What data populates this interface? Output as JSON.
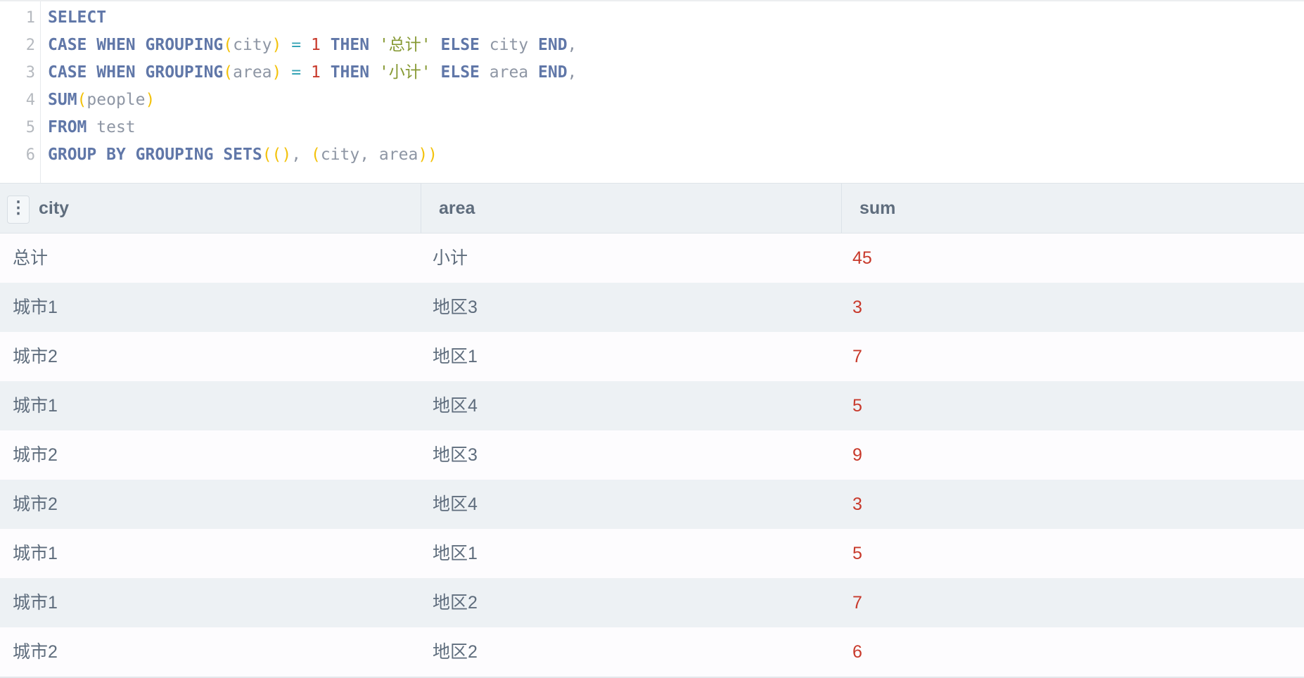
{
  "editor": {
    "line_numbers": [
      "1",
      "2",
      "3",
      "4",
      "5",
      "6"
    ],
    "lines": [
      [
        {
          "t": "SELECT",
          "k": "kw"
        }
      ],
      [
        {
          "t": "CASE",
          "k": "kw"
        },
        {
          "t": " ",
          "k": "punct"
        },
        {
          "t": "WHEN",
          "k": "kw"
        },
        {
          "t": " ",
          "k": "punct"
        },
        {
          "t": "GROUPING",
          "k": "kw"
        },
        {
          "t": "(",
          "k": "paren"
        },
        {
          "t": "city",
          "k": "id"
        },
        {
          "t": ")",
          "k": "paren"
        },
        {
          "t": " ",
          "k": "punct"
        },
        {
          "t": "=",
          "k": "op"
        },
        {
          "t": " ",
          "k": "punct"
        },
        {
          "t": "1",
          "k": "num"
        },
        {
          "t": " ",
          "k": "punct"
        },
        {
          "t": "THEN",
          "k": "kw"
        },
        {
          "t": " ",
          "k": "punct"
        },
        {
          "t": "'总计'",
          "k": "str"
        },
        {
          "t": " ",
          "k": "punct"
        },
        {
          "t": "ELSE",
          "k": "kw"
        },
        {
          "t": " ",
          "k": "punct"
        },
        {
          "t": "city",
          "k": "id"
        },
        {
          "t": " ",
          "k": "punct"
        },
        {
          "t": "END",
          "k": "kw"
        },
        {
          "t": ",",
          "k": "punct"
        }
      ],
      [
        {
          "t": "CASE",
          "k": "kw"
        },
        {
          "t": " ",
          "k": "punct"
        },
        {
          "t": "WHEN",
          "k": "kw"
        },
        {
          "t": " ",
          "k": "punct"
        },
        {
          "t": "GROUPING",
          "k": "kw"
        },
        {
          "t": "(",
          "k": "paren"
        },
        {
          "t": "area",
          "k": "id"
        },
        {
          "t": ")",
          "k": "paren"
        },
        {
          "t": " ",
          "k": "punct"
        },
        {
          "t": "=",
          "k": "op"
        },
        {
          "t": " ",
          "k": "punct"
        },
        {
          "t": "1",
          "k": "num"
        },
        {
          "t": " ",
          "k": "punct"
        },
        {
          "t": "THEN",
          "k": "kw"
        },
        {
          "t": " ",
          "k": "punct"
        },
        {
          "t": "'小计'",
          "k": "str"
        },
        {
          "t": " ",
          "k": "punct"
        },
        {
          "t": "ELSE",
          "k": "kw"
        },
        {
          "t": " ",
          "k": "punct"
        },
        {
          "t": "area",
          "k": "id"
        },
        {
          "t": " ",
          "k": "punct"
        },
        {
          "t": "END",
          "k": "kw"
        },
        {
          "t": ",",
          "k": "punct"
        }
      ],
      [
        {
          "t": "SUM",
          "k": "kw"
        },
        {
          "t": "(",
          "k": "paren"
        },
        {
          "t": "people",
          "k": "id"
        },
        {
          "t": ")",
          "k": "paren"
        }
      ],
      [
        {
          "t": "FROM",
          "k": "kw"
        },
        {
          "t": " ",
          "k": "punct"
        },
        {
          "t": "test",
          "k": "id"
        }
      ],
      [
        {
          "t": "GROUP",
          "k": "kw"
        },
        {
          "t": " ",
          "k": "punct"
        },
        {
          "t": "BY",
          "k": "kw"
        },
        {
          "t": " ",
          "k": "punct"
        },
        {
          "t": "GROUPING",
          "k": "kw"
        },
        {
          "t": " ",
          "k": "punct"
        },
        {
          "t": "SETS",
          "k": "kw"
        },
        {
          "t": "((",
          "k": "paren"
        },
        {
          "t": ")",
          "k": "paren"
        },
        {
          "t": ", ",
          "k": "punct"
        },
        {
          "t": "(",
          "k": "paren"
        },
        {
          "t": "city",
          "k": "id"
        },
        {
          "t": ", ",
          "k": "punct"
        },
        {
          "t": "area",
          "k": "id"
        },
        {
          "t": "))",
          "k": "paren"
        }
      ]
    ]
  },
  "grid": {
    "menu_icon": "⋮",
    "columns": [
      "city",
      "area",
      "sum"
    ],
    "rows": [
      [
        "总计",
        "小计",
        "45"
      ],
      [
        "城市1",
        "地区3",
        "3"
      ],
      [
        "城市2",
        "地区1",
        "7"
      ],
      [
        "城市1",
        "地区4",
        "5"
      ],
      [
        "城市2",
        "地区3",
        "9"
      ],
      [
        "城市2",
        "地区4",
        "3"
      ],
      [
        "城市1",
        "地区1",
        "5"
      ],
      [
        "城市1",
        "地区2",
        "7"
      ],
      [
        "城市2",
        "地区2",
        "6"
      ]
    ]
  }
}
